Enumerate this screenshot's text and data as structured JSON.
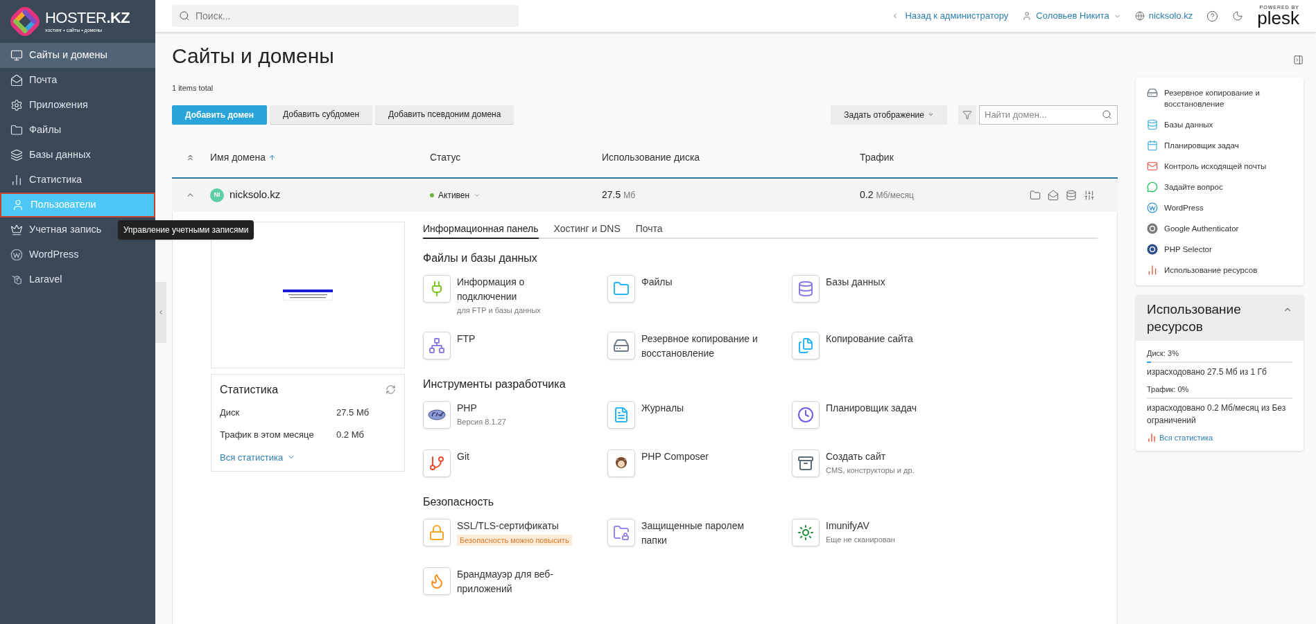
{
  "logo": {
    "wordmark": "HOSTER**.KZ**",
    "tagline": "хостинг • сайты • домены"
  },
  "search": {
    "placeholder": "Поиск..."
  },
  "sidebar": {
    "items": [
      {
        "label": "Сайты и домены",
        "selected": true,
        "hovered": false
      },
      {
        "label": "Почта",
        "selected": false,
        "hovered": false
      },
      {
        "label": "Приложения",
        "selected": false,
        "hovered": false
      },
      {
        "label": "Файлы",
        "selected": false,
        "hovered": false
      },
      {
        "label": "Базы данных",
        "selected": false,
        "hovered": false
      },
      {
        "label": "Статистика",
        "selected": false,
        "hovered": false
      },
      {
        "label": "Пользователи",
        "selected": false,
        "hovered": true,
        "tooltip": "Управление учетными записями"
      },
      {
        "label": "Учетная запись",
        "selected": false,
        "hovered": false
      },
      {
        "label": "WordPress",
        "selected": false,
        "hovered": false
      },
      {
        "label": "Laravel",
        "selected": false,
        "hovered": false
      }
    ]
  },
  "topbar": {
    "back": "Назад к администратору",
    "user": "Соловьев Никита",
    "domain": "nicksolo.kz",
    "powered": "POWERED BY",
    "brand": "plesk"
  },
  "page": {
    "title": "Сайты и домены",
    "count": "1 items total"
  },
  "toolbar": {
    "buttons": [
      {
        "label": "Добавить домен",
        "primary": true
      },
      {
        "label": "Добавить субдомен",
        "primary": false
      },
      {
        "label": "Добавить псевдоним домена",
        "primary": false
      }
    ],
    "view": "Задать отображение",
    "search_placeholder": "Найти домен..."
  },
  "table": {
    "columns": [
      {
        "label": "Имя домена",
        "sorted": true
      },
      {
        "label": "Статус",
        "sorted": false
      },
      {
        "label": "Использование диска",
        "sorted": false
      },
      {
        "label": "Трафик",
        "sorted": false
      }
    ],
    "rows": [
      {
        "avatar": "NI",
        "domain": "nicksolo.kz",
        "status": "Активен",
        "disk": "27.5",
        "disk_unit": "Мб",
        "traffic": "0.2",
        "traffic_unit": "Мб/месяц",
        "expanded": true
      }
    ]
  },
  "details": {
    "stats": {
      "title": "Статистика",
      "rows": [
        {
          "label": "Диск",
          "value": "27.5 Мб"
        },
        {
          "label": "Трафик в этом месяце",
          "value": "0.2 Мб"
        }
      ],
      "link": "Вся статистика"
    },
    "tabs": [
      {
        "label": "Информационная панель",
        "selected": true
      },
      {
        "label": "Хостинг и DNS",
        "selected": false
      },
      {
        "label": "Почта",
        "selected": false
      }
    ],
    "sections": [
      {
        "title": "Файлы и базы данных",
        "tools": [
          {
            "label": "Информация о подключении",
            "note": "для FTP и базы данных"
          },
          {
            "label": "Файлы"
          },
          {
            "label": "Базы данных"
          },
          {
            "label": "FTP"
          },
          {
            "label": "Резервное копирование и восстановление"
          },
          {
            "label": "Копирование сайта"
          }
        ]
      },
      {
        "title": "Инструменты разработчика",
        "tools": [
          {
            "label": "PHP",
            "note": "Версия 8.1.27"
          },
          {
            "label": "Журналы"
          },
          {
            "label": "Планировщик задач"
          },
          {
            "label": "Git"
          },
          {
            "label": "PHP Composer"
          },
          {
            "label": "Создать сайт",
            "note": "CMS, конструкторы и др."
          }
        ]
      },
      {
        "title": "Безопасность",
        "tools": [
          {
            "label": "SSL/TLS-сертификаты",
            "badge": "Безопасность можно повысить"
          },
          {
            "label": "Защищенные паролем папки"
          },
          {
            "label": "ImunifyAV",
            "note": "Еще не сканирован"
          },
          {
            "label": "Брандмауэр для веб-приложений"
          }
        ]
      }
    ]
  },
  "links": [
    "Резервное копирование и восстановление",
    "Базы данных",
    "Планировщик задач",
    "Контроль исходящей почты",
    "Задайте вопрос",
    "WordPress",
    "Google Authenticator",
    "PHP Selector",
    "Использование ресурсов"
  ],
  "resources": {
    "title": "Использование ресурсов",
    "expanded": true,
    "meters": [
      {
        "label": "Диск: 3%",
        "level": 0.03,
        "detail": "израсходовано 27.5 Мб из 1 Гб"
      },
      {
        "label": "Трафик: 0%",
        "level": 0,
        "detail": "израсходовано 0.2 Мб/месяц из Без ограничений"
      }
    ],
    "link": "Вся статистика"
  }
}
